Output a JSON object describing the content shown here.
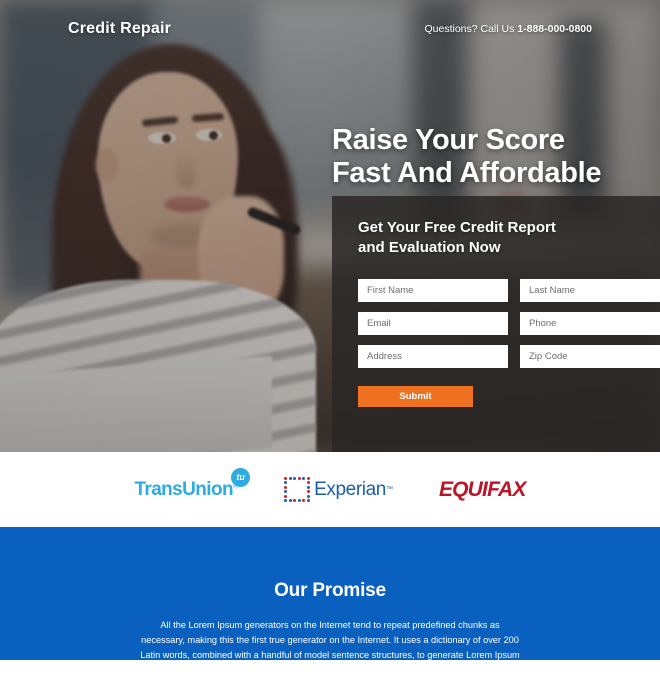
{
  "header": {
    "brand": "Credit Repair",
    "phone_prefix": "Questions? Call Us ",
    "phone_number": "1-888-000-0800"
  },
  "hero": {
    "headline_line1": "Raise Your Score",
    "headline_line2": "Fast And Affordable"
  },
  "form": {
    "title_line1": "Get Your Free Credit Report",
    "title_line2": "and Evaluation Now",
    "fields": [
      {
        "name": "first-name",
        "placeholder": "First Name",
        "value": ""
      },
      {
        "name": "last-name",
        "placeholder": "Last Name",
        "value": ""
      },
      {
        "name": "email",
        "placeholder": "Email",
        "value": ""
      },
      {
        "name": "phone",
        "placeholder": "Phone",
        "value": ""
      },
      {
        "name": "address",
        "placeholder": "Address",
        "value": ""
      },
      {
        "name": "zip-code",
        "placeholder": "Zip Code",
        "value": ""
      }
    ],
    "submit_label": "Submit"
  },
  "bureaus": [
    {
      "name": "TransUnion",
      "label": "TransUnion",
      "badge": "tu",
      "mark": "®",
      "color": "#2eabe2"
    },
    {
      "name": "Experian",
      "label": "Experian",
      "mark": "™",
      "color": "#1b5fab",
      "dot_accent": "#d3202a"
    },
    {
      "name": "Equifax",
      "label": "EQUIFAX",
      "color": "#ba1528"
    }
  ],
  "promise": {
    "heading": "Our Promise",
    "body": "All the Lorem Ipsum generators on the Internet tend to repeat predefined chunks as necessary, making this the first true generator on the Internet. It uses a dictionary of over 200 Latin words, combined with a handful of model sentence structures, to generate Lorem Ipsum which looks reasonable. The generated Lorem Ipsum is therefore always free from repetition."
  },
  "colors": {
    "accent_orange": "#ef7122",
    "promise_blue": "#0a60bf",
    "panel_dark": "#282625"
  }
}
